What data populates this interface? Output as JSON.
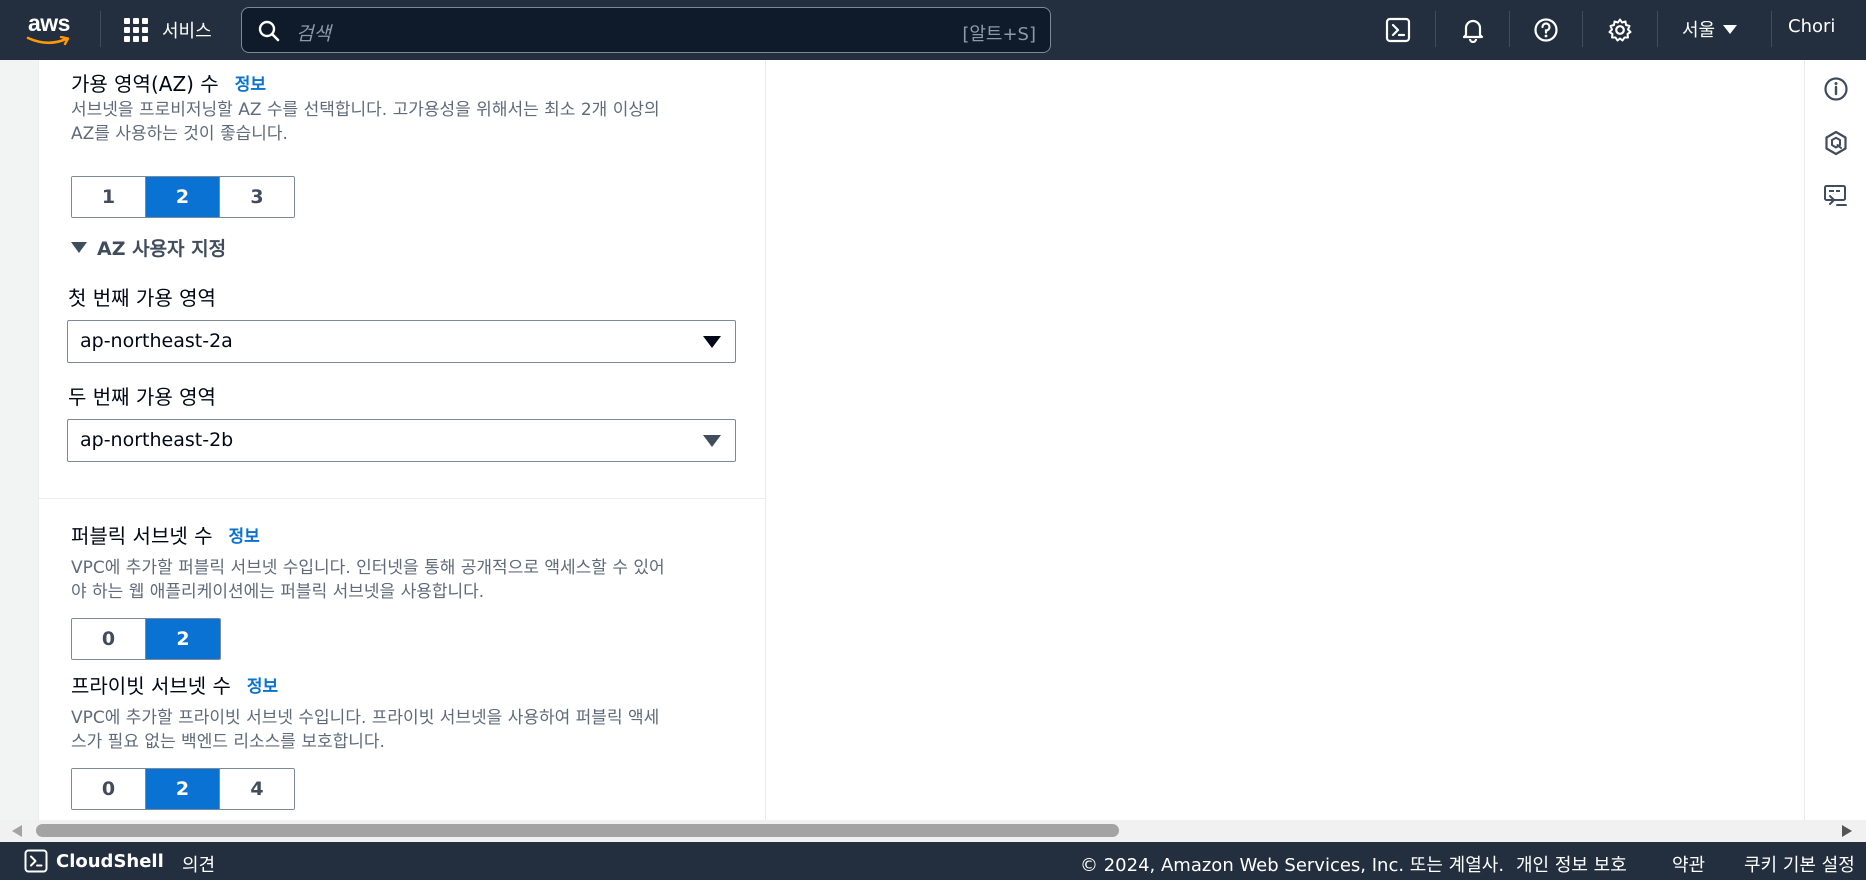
{
  "topnav": {
    "logo_text": "aws",
    "services_label": "서비스",
    "search_placeholder": "검색",
    "search_shortcut": "[알트+S]",
    "region": "서울",
    "user": "Chori",
    "icons": [
      "cloudshell-icon",
      "notifications-icon",
      "help-icon",
      "settings-icon"
    ]
  },
  "az": {
    "title": "가용 영역(AZ) 수",
    "info": "정보",
    "description_line1": "서브넷을 프로비저닝할 AZ 수를 선택합니다. 고가용성을 위해서는 최소 2개 이상의",
    "description_line2": "AZ를 사용하는 것이 좋습니다.",
    "options": [
      "1",
      "2",
      "3"
    ],
    "selected": "2",
    "customize_label": "AZ 사용자 지정",
    "first_label": "첫 번째 가용 영역",
    "first_value": "ap-northeast-2a",
    "second_label": "두 번째 가용 영역",
    "second_value": "ap-northeast-2b"
  },
  "public_subnets": {
    "title": "퍼블릭 서브넷 수",
    "info": "정보",
    "description_line1": "VPC에 추가할 퍼블릭 서브넷 수입니다. 인터넷을 통해 공개적으로 액세스할 수 있어",
    "description_line2": "야 하는 웹 애플리케이션에는 퍼블릭 서브넷을 사용합니다.",
    "options": [
      "0",
      "2"
    ],
    "selected": "2"
  },
  "private_subnets": {
    "title": "프라이빗 서브넷 수",
    "info": "정보",
    "description_line1": "VPC에 추가할 프라이빗 서브넷 수입니다. 프라이빗 서브넷을 사용하여 퍼블릭 액세",
    "description_line2": "스가 필요 없는 백엔드 리소스를 보호합니다.",
    "options": [
      "0",
      "2",
      "4"
    ],
    "selected": "2"
  },
  "rail_icons": [
    "info-icon",
    "amazon-q-icon",
    "console-toolbar-icon"
  ],
  "footer": {
    "cloudshell": "CloudShell",
    "feedback": "의견",
    "copyright": "© 2024, Amazon Web Services, Inc. 또는 계열사.",
    "privacy": "개인 정보 보호",
    "terms": "약관",
    "cookies": "쿠키 기본 설정"
  },
  "colors": {
    "nav_bg": "#232f3e",
    "accent": "#0972d3",
    "text": "#000716",
    "muted": "#5f6b7a"
  }
}
